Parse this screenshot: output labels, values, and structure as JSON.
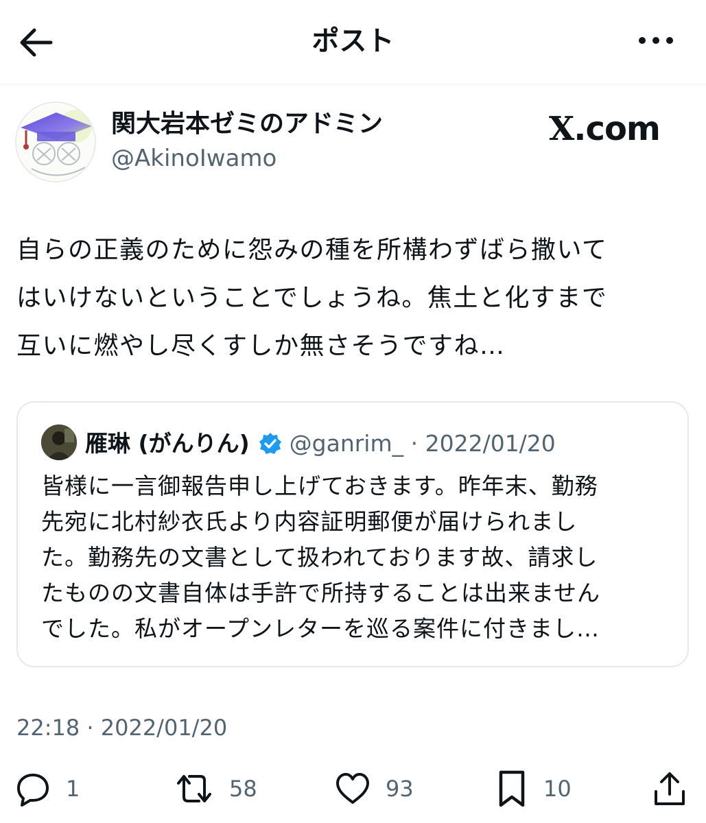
{
  "header": {
    "title": "ポスト",
    "back_icon": "arrow-left-icon",
    "more_icon": "more-horizontal-icon"
  },
  "post": {
    "author": {
      "name": "関大岩本ゼミのアドミン",
      "handle": "@AkinoIwamo"
    },
    "brand": "X.com",
    "text": "自らの正義のために怨みの種を所構わずばら撒いて\nはいけないということでしょうね。焦土と化すまで\n互いに燃やし尽くすしか無さそうですね…",
    "timestamp": "22:18 · 2022/01/20"
  },
  "quote": {
    "name": "雁琳 (がんりん)",
    "verified": true,
    "meta": "@ganrim_ · 2022/01/20",
    "text": "皆様に一言御報告申し上げておきます。昨年末、勤務\n先宛に北村紗衣氏より内容証明郵便が届けられまし\nた。勤務先の文書として扱われております故、請求し\nたものの文書自体は手許で所持することは出来ません\nでした。私がオープンレターを巡る案件に付きまし…"
  },
  "actions": {
    "reply": {
      "icon": "reply-icon",
      "count": "1"
    },
    "repost": {
      "icon": "repost-icon",
      "count": "58"
    },
    "like": {
      "icon": "heart-icon",
      "count": "93"
    },
    "bookmark": {
      "icon": "bookmark-icon",
      "count": "10"
    },
    "share": {
      "icon": "share-icon"
    }
  },
  "colors": {
    "text": "#0f1419",
    "secondary": "#536471",
    "verified": "#1d9bf0",
    "border": "#e6e9ec"
  }
}
